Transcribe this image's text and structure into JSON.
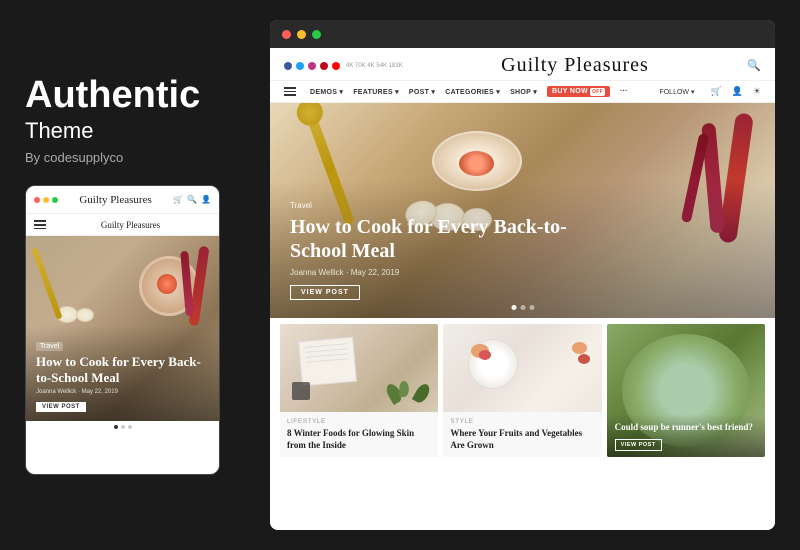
{
  "left": {
    "title": "Authentic",
    "subtitle": "Theme",
    "author": "By codesupplyco"
  },
  "mobile": {
    "dots": [
      "●",
      "●",
      "●"
    ],
    "logo": "Guilty Pleasures",
    "nav_logo": "Guilty Pleasures",
    "hero_tag": "Travel",
    "hero_title": "How to Cook for Every Back-to-School Meal",
    "hero_meta": "Joanna Wellick · May 22, 2019",
    "view_post": "VIEW POST"
  },
  "desktop": {
    "chrome_dots": [
      "red",
      "yellow",
      "green"
    ],
    "social_counts": "4K  70K  4K  54K  183K",
    "logo": "Guilty Pleasures",
    "nav_items": [
      "DEMOS",
      "FEATURES",
      "POST",
      "CATEGORIES",
      "SHOP",
      "BUY NOW",
      "···",
      "FOLLOW",
      "···"
    ],
    "hero_tag": "Travel",
    "hero_title": "How to Cook for Every Back-to-School Meal",
    "hero_meta": "Joanna Wellick · May 22, 2019",
    "hero_view_btn": "VIEW POST",
    "cards": [
      {
        "category": "Lifestyle",
        "title": "8 Winter Foods for Glowing Skin from the Inside",
        "excerpt": ""
      },
      {
        "category": "Style",
        "title": "Where Your Fruits and Vegetables Are Grown",
        "excerpt": ""
      },
      {
        "category": "",
        "title": "Could soup be runner's best friend?",
        "view_btn": "VIEW POST"
      }
    ]
  }
}
